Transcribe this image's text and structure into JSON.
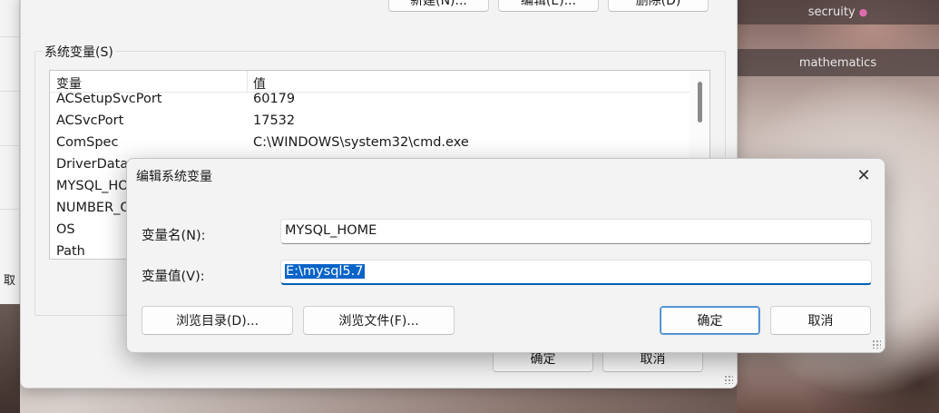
{
  "background": {
    "tag_top": "secruity",
    "tag_mid": "mathematics",
    "left_edge_text": "取"
  },
  "parent_dialog": {
    "top_buttons": [
      "新建(N)...",
      "编辑(E)...",
      "删除(D)"
    ],
    "group_title": "系统变量(S)",
    "columns": [
      "变量",
      "值"
    ],
    "rows": [
      {
        "name": "ACSetupSvcPort",
        "value": "60179"
      },
      {
        "name": "ACSvcPort",
        "value": "17532"
      },
      {
        "name": "ComSpec",
        "value": "C:\\WINDOWS\\system32\\cmd.exe"
      },
      {
        "name": "DriverData",
        "value": ""
      },
      {
        "name": "MYSQL_HO",
        "value": ""
      },
      {
        "name": "NUMBER_O",
        "value": ""
      },
      {
        "name": "OS",
        "value": ""
      },
      {
        "name": "Path",
        "value": ""
      }
    ],
    "ok_label": "确定",
    "cancel_label": "取消"
  },
  "edit_dialog": {
    "title": "编辑系统变量",
    "close_glyph": "✕",
    "name_label": "变量名(N):",
    "name_value": "MYSQL_HOME",
    "value_label": "变量值(V):",
    "value_value": "E:\\mysql5.7",
    "browse_dir_label": "浏览目录(D)...",
    "browse_file_label": "浏览文件(F)...",
    "ok_label": "确定",
    "cancel_label": "取消"
  }
}
